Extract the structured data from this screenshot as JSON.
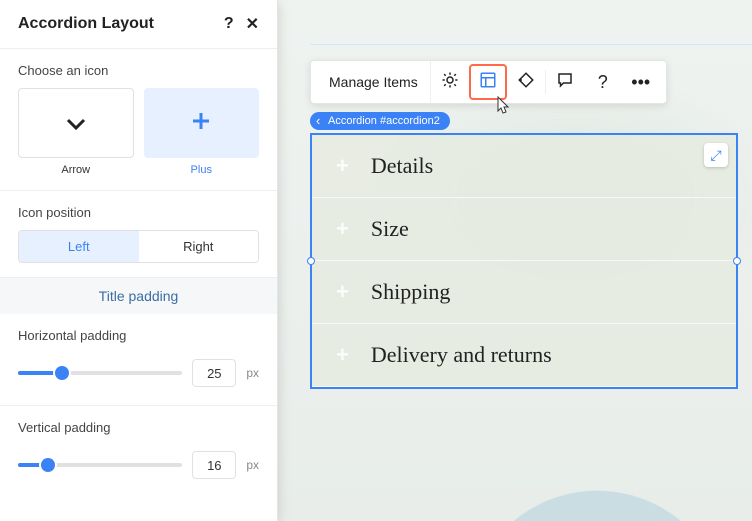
{
  "panel": {
    "title": "Accordion Layout",
    "chooseIcon": {
      "label": "Choose an icon",
      "options": [
        {
          "name": "Arrow",
          "selected": false
        },
        {
          "name": "Plus",
          "selected": true
        }
      ]
    },
    "iconPosition": {
      "label": "Icon position",
      "options": [
        "Left",
        "Right"
      ],
      "selected": "Left"
    },
    "titlePadding": {
      "label": "Title padding",
      "horizontal": {
        "label": "Horizontal padding",
        "value": 25,
        "unit": "px",
        "percent": 27
      },
      "vertical": {
        "label": "Vertical padding",
        "value": 16,
        "unit": "px",
        "percent": 18
      }
    }
  },
  "toolbar": {
    "label": "Manage Items"
  },
  "selection": {
    "tag": "Accordion #accordion2"
  },
  "accordion": {
    "items": [
      "Details",
      "Size",
      "Shipping",
      "Delivery and returns"
    ]
  }
}
